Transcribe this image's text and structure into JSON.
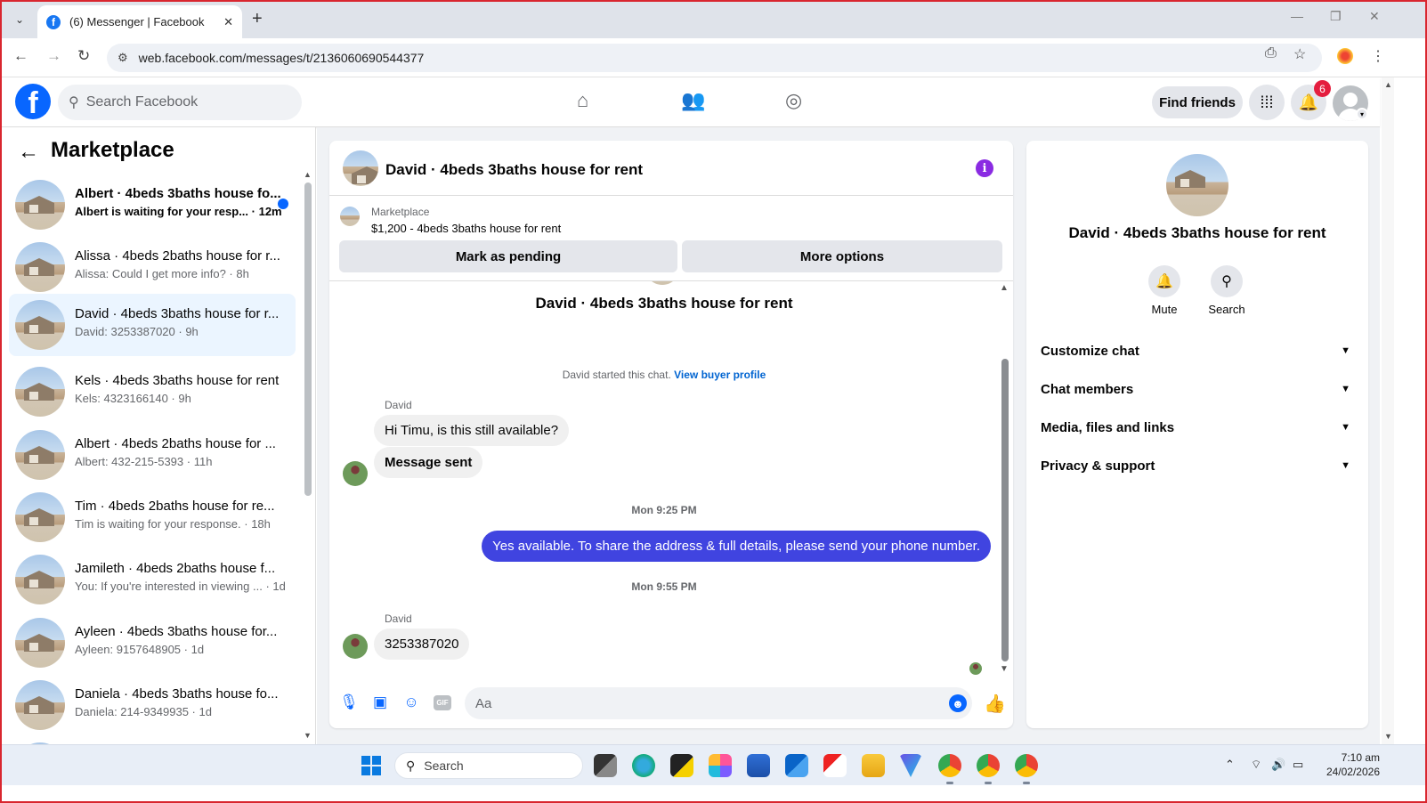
{
  "browser": {
    "tab_title": "(6) Messenger | Facebook",
    "tab_favicon": "f",
    "url": "web.facebook.com/messages/t/2136060690544377"
  },
  "fb": {
    "search_placeholder": "Search Facebook",
    "find_friends": "Find friends",
    "notification_count": "6"
  },
  "left": {
    "title": "Marketplace",
    "conversations": [
      {
        "name": "Albert · 4beds 3baths house fo...",
        "sub": "Albert is waiting for your resp... · 12m",
        "unread": true
      },
      {
        "name": "Alissa · 4beds 2baths house for r...",
        "sub": "Alissa: Could I get more info? · 8h"
      },
      {
        "name": "David · 4beds 3baths house for r...",
        "sub": "David: 3253387020 · 9h",
        "active": true
      },
      {
        "name": "Kels · 4beds 3baths house for rent",
        "sub": "Kels: 4323166140 · 9h"
      },
      {
        "name": "Albert · 4beds 2baths house for ...",
        "sub": "Albert: 432-215-5393 · 11h"
      },
      {
        "name": "Tim · 4beds 2baths house for re...",
        "sub": "Tim is waiting for your response. · 18h"
      },
      {
        "name": "Jamileth · 4beds 2baths house f...",
        "sub": "You: If you're interested in viewing ... · 1d"
      },
      {
        "name": "Ayleen · 4beds 3baths house for...",
        "sub": "Ayleen: 9157648905 · 1d"
      },
      {
        "name": "Daniela · 4beds 3baths house fo...",
        "sub": "Daniela: 214-9349935 · 1d"
      }
    ]
  },
  "chat": {
    "title": "David · 4beds 3baths house for rent",
    "marketplace_label": "Marketplace",
    "listing": "$1,200 - 4beds 3baths house for rent",
    "mark_pending": "Mark as pending",
    "more_options": "More options",
    "intro_name": "David · 4beds 3baths house for rent",
    "started_text": "David started this chat.",
    "view_buyer_profile": "View buyer profile",
    "sender1": "David",
    "msg1": "Hi Timu, is this still available?",
    "msg2": "Message sent",
    "ts1": "Mon 9:25 PM",
    "msg3": "Yes available. To share the address & full details, please send your phone number.",
    "ts2": "Mon 9:55 PM",
    "sender2": "David",
    "msg4": "3253387020",
    "composer_placeholder": "Aa",
    "gif_label": "GIF"
  },
  "right": {
    "title": "David · 4beds 3baths house for rent",
    "mute": "Mute",
    "search": "Search",
    "sections": [
      "Customize chat",
      "Chat members",
      "Media, files and links",
      "Privacy & support"
    ]
  },
  "taskbar": {
    "search_placeholder": "Search",
    "time": "7:10 am",
    "date": "24/02/2026"
  },
  "colors": {
    "fb_blue": "#0866ff",
    "outgoing_bubble": "#4044e0",
    "info_icon": "#8a2be2",
    "badge_red": "#e41e3f"
  }
}
